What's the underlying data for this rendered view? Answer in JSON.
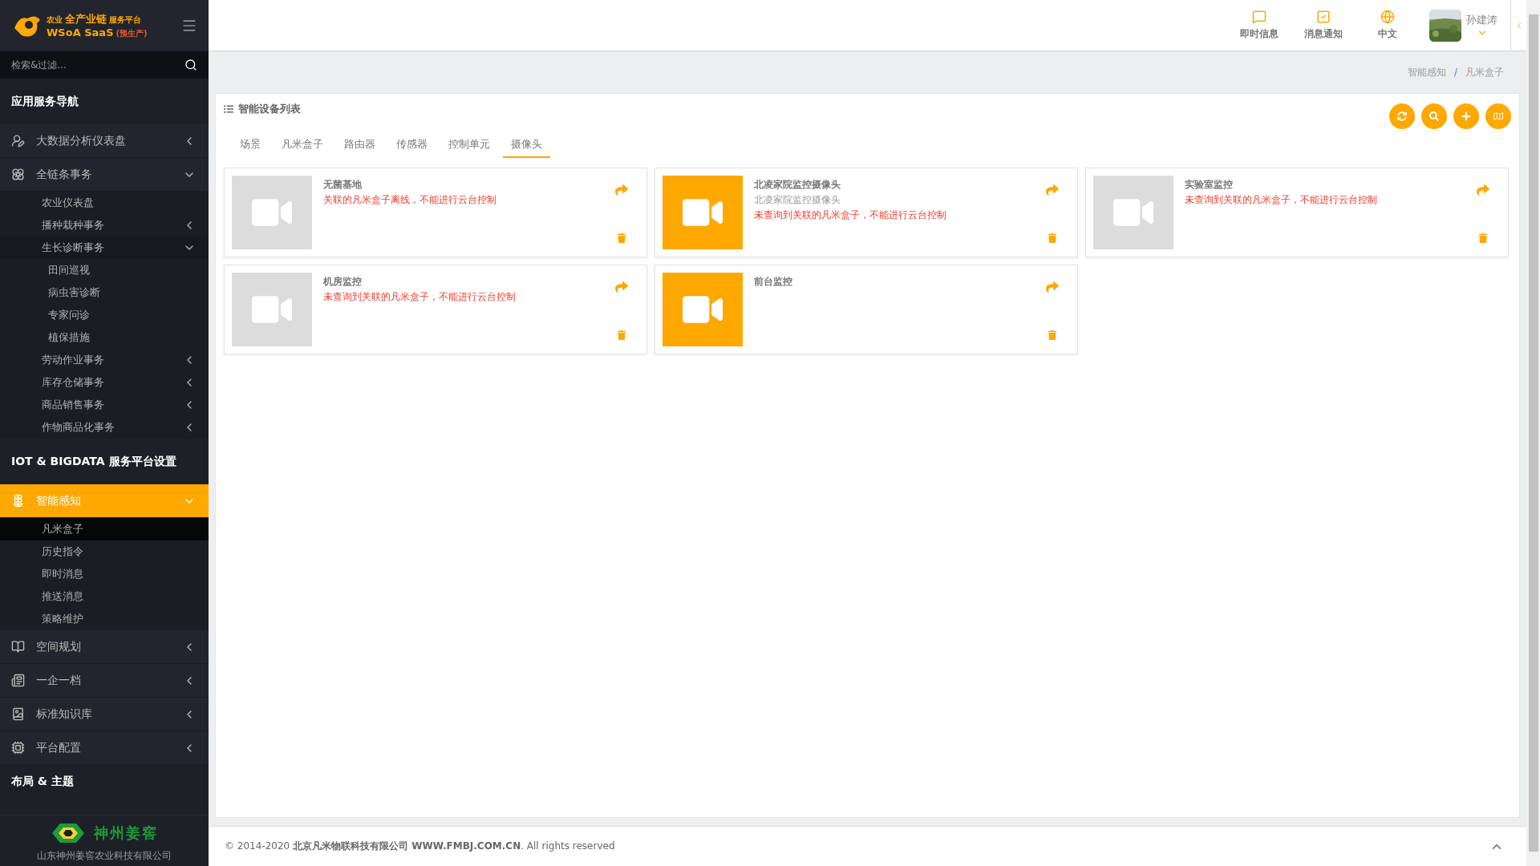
{
  "sidebar": {
    "logo": {
      "lines": [
        "农业",
        "全产业链",
        "服务平台",
        "WSoA SaaS",
        "(预生产)"
      ]
    },
    "search": {
      "placeholder": "检索&过滤..."
    },
    "sections": [
      {
        "title": "应用服务导航",
        "items": [
          {
            "label": "大数据分析仪表盘",
            "expanded": false,
            "selected": false
          },
          {
            "label": "全链条事务",
            "expanded": true,
            "selected": false,
            "children": [
              {
                "label": "农业仪表盘",
                "selected": false
              },
              {
                "label": "播种栽种事务",
                "expanded": false,
                "selected": false
              },
              {
                "label": "生长诊断事务",
                "expanded": true,
                "selected": false,
                "children": [
                  {
                    "label": "田间巡视",
                    "selected": false
                  },
                  {
                    "label": "病虫害诊断",
                    "selected": false
                  },
                  {
                    "label": "专家问诊",
                    "selected": false
                  },
                  {
                    "label": "植保措施",
                    "selected": false
                  }
                ]
              },
              {
                "label": "劳动作业事务",
                "expanded": false,
                "selected": false
              },
              {
                "label": "库存仓储事务",
                "expanded": false,
                "selected": false
              },
              {
                "label": "商品销售事务",
                "expanded": false,
                "selected": false
              },
              {
                "label": "作物商品化事务",
                "expanded": false,
                "selected": false
              }
            ]
          }
        ]
      },
      {
        "title": "IOT & BIGDATA 服务平台设置",
        "items": [
          {
            "label": "智能感知",
            "expanded": true,
            "selected": true,
            "children": [
              {
                "label": "凡米盒子",
                "selected": true
              },
              {
                "label": "历史指令",
                "selected": false
              },
              {
                "label": "即时消息",
                "selected": false
              },
              {
                "label": "推送消息",
                "selected": false
              },
              {
                "label": "策略维护",
                "selected": false
              }
            ]
          },
          {
            "label": "空间规划",
            "expanded": false,
            "selected": false
          },
          {
            "label": "一企一档",
            "expanded": false,
            "selected": false
          },
          {
            "label": "标准知识库",
            "expanded": false,
            "selected": false
          },
          {
            "label": "平台配置",
            "expanded": false,
            "selected": false
          }
        ]
      },
      {
        "title": "布局 & 主题"
      }
    ],
    "brand": {
      "name": "神州姜窖",
      "company": "山东神州姜窖农业科技有限公司"
    }
  },
  "topbar": {
    "actions": [
      {
        "label": "即时信息"
      },
      {
        "label": "消息通知"
      },
      {
        "label": "中文"
      }
    ],
    "user": {
      "name": "孙建涛"
    }
  },
  "breadcrumb": {
    "items": [
      "智能感知",
      "凡米盒子"
    ],
    "separator": "/"
  },
  "panel": {
    "title": "智能设备列表",
    "tabs": [
      {
        "label": "场景",
        "selected": false
      },
      {
        "label": "凡米盒子",
        "selected": false
      },
      {
        "label": "路由器",
        "selected": false
      },
      {
        "label": "传感器",
        "selected": false
      },
      {
        "label": "控制单元",
        "selected": false
      },
      {
        "label": "摄像头",
        "selected": true
      }
    ],
    "devices": [
      {
        "name": "无菌基地",
        "message": "关联的凡米盒子离线，不能进行云台控制",
        "active": false
      },
      {
        "name": "北凌家院监控摄像头",
        "subtitle": "北凌家院监控摄像头",
        "message": "未查询到关联的凡米盒子，不能进行云台控制",
        "active": true
      },
      {
        "name": "实验室监控",
        "message": "未查询到关联的凡米盒子，不能进行云台控制",
        "active": false
      },
      {
        "name": "机房监控",
        "message": "未查询到关联的凡米盒子，不能进行云台控制",
        "active": false
      },
      {
        "name": "前台监控",
        "active": true
      }
    ]
  },
  "footer": {
    "text": "© 2014-2020 **北京凡米物联科技有限公司 WWW.FMBJ.COM.CN**. All rights reserved"
  }
}
